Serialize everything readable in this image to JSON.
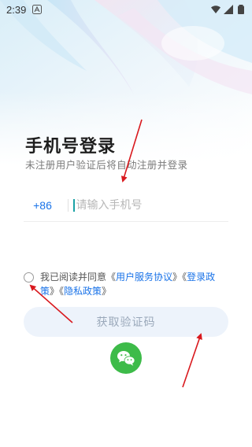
{
  "status_bar": {
    "time": "2:39",
    "icons": [
      "a-notification-icon",
      "wifi-icon",
      "signal-icon",
      "battery-icon"
    ]
  },
  "login": {
    "title": "手机号登录",
    "subtitle": "未注册用户验证后将自动注册并登录",
    "country_code": "+86",
    "phone_placeholder": "请输入手机号",
    "phone_value": ""
  },
  "agreement": {
    "prefix": "我已阅读并同意",
    "open_quote_1": "《",
    "link_user_service": "用户服务协议",
    "close_quote_1": "》",
    "open_quote_2": "《",
    "link_login_policy": "登录政策",
    "close_quote_2": "》",
    "open_quote_3": "《",
    "link_privacy": "隐私政策",
    "close_quote_3": "》",
    "checked": false
  },
  "buttons": {
    "get_code": "获取验证码",
    "wechat_icon": "wechat-icon"
  },
  "colors": {
    "accent": "#1a73e8",
    "button_bg": "#edf3fb",
    "button_text": "#9aa8ba",
    "wechat_green": "#3dbb49",
    "annotation_red": "#d9191e"
  }
}
